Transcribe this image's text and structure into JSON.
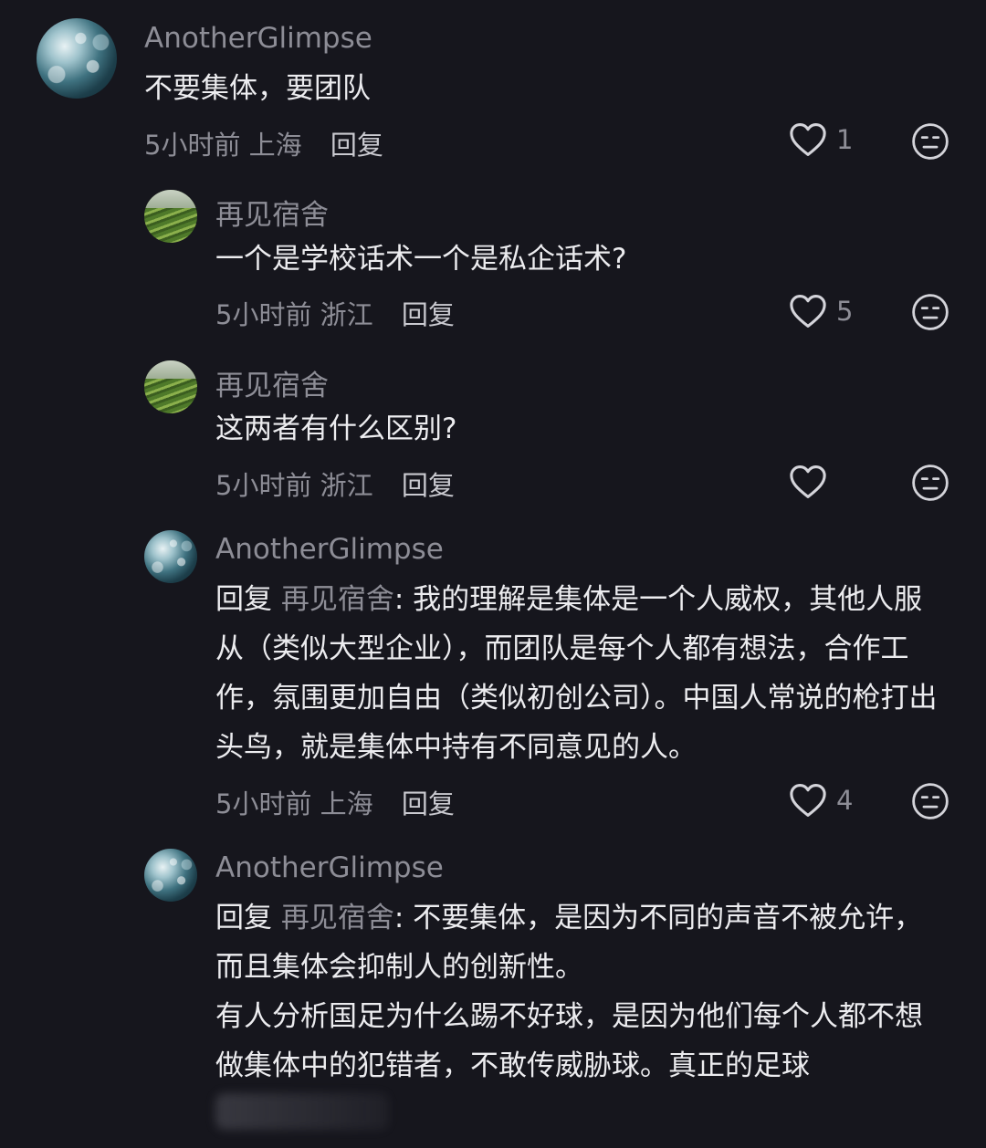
{
  "comments": [
    {
      "username": "AnotherGlimpse",
      "text": "不要集体，要团队",
      "time": "5小时前",
      "location": "上海",
      "reply_label": "回复",
      "likes": "1",
      "avatar": "wave-avatar"
    },
    {
      "username": "再见宿舍",
      "text": "一个是学校话术一个是私企话术?",
      "time": "5小时前",
      "location": "浙江",
      "reply_label": "回复",
      "likes": "5",
      "avatar": "field-avatar"
    },
    {
      "username": "再见宿舍",
      "text": "这两者有什么区别?",
      "time": "5小时前",
      "location": "浙江",
      "reply_label": "回复",
      "likes": "",
      "avatar": "field-avatar"
    },
    {
      "username": "AnotherGlimpse",
      "reply_prefix": "回复",
      "reply_target": "再见宿舍",
      "text": ": 我的理解是集体是一个人威权，其他人服从（类似大型企业），而团队是每个人都有想法，合作工作，氛围更加自由（类似初创公司）。中国人常说的枪打出头鸟，就是集体中持有不同意见的人。",
      "time": "5小时前",
      "location": "上海",
      "reply_label": "回复",
      "likes": "4",
      "avatar": "wave-avatar"
    },
    {
      "username": "AnotherGlimpse",
      "reply_prefix": "回复",
      "reply_target": "再见宿舍",
      "text": ": 不要集体，是因为不同的声音不被允许，而且集体会抑制人的创新性。",
      "text2": "有人分析国足为什么踢不好球，是因为他们每个人都不想做集体中的犯错者，不敢传威胁球。真正的足球",
      "avatar": "wave-avatar"
    }
  ],
  "icons": {
    "like": "heart-outline-icon",
    "dislike": "neutral-face-icon"
  },
  "colors": {
    "background": "#16161d",
    "text_primary": "#ececef",
    "text_secondary": "#8d8d96"
  }
}
